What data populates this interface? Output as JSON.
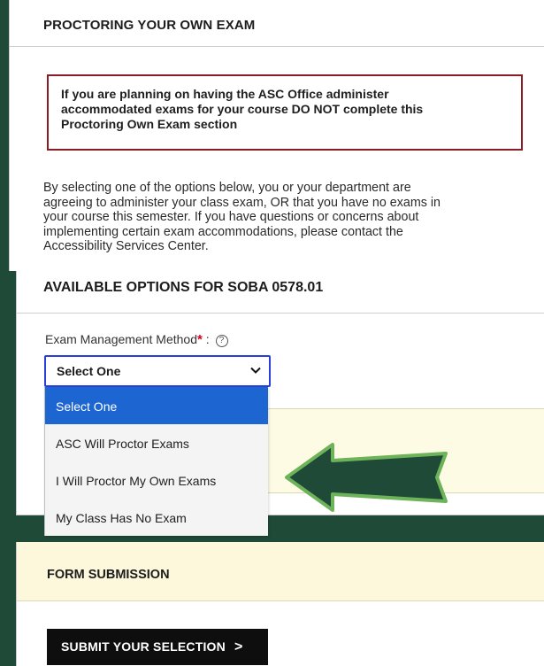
{
  "proctoring": {
    "title": "PROCTORING YOUR OWN EXAM",
    "warning_line1": "If you are planning on having the ASC Office administer",
    "warning_line2": "accommodated exams for your course DO NOT complete this",
    "warning_line3": "Proctoring Own Exam section",
    "intro_line1": "By selecting one of the options below, you or your department are",
    "intro_line2": "agreeing to administer your class exam, OR that you have no exams in",
    "intro_line3": "your course this semester. If you have questions or concerns about",
    "intro_line4": "implementing certain exam accommodations, please contact the",
    "intro_line5": "Accessibility Services Center."
  },
  "options": {
    "title": "AVAILABLE OPTIONS FOR SOBA 0578.01",
    "field_label": "Exam Management Method",
    "required_mark": "*",
    "label_suffix": " :",
    "help_glyph": "?",
    "selected_value": "Select One",
    "dropdown_options": [
      "Select One",
      "ASC Will Proctor Exams",
      "I Will Proctor My Own Exams",
      "My Class Has No Exam"
    ]
  },
  "submission": {
    "title": "FORM SUBMISSION",
    "button_label": "SUBMIT YOUR SELECTION",
    "button_arrow": ">"
  },
  "icons": {
    "help": "help-circle-icon",
    "chevron": "chevron-down-icon",
    "annotation_arrow": "left-arrow-icon"
  },
  "colors": {
    "background": "#1f4a37",
    "warning_border": "#8b1c24",
    "select_border": "#2b3fd8",
    "selected_option": "#1d66d2",
    "notice_background": "#fdfbe3",
    "arrow_fill": "#1f4a37",
    "arrow_outline": "#6db35a"
  }
}
